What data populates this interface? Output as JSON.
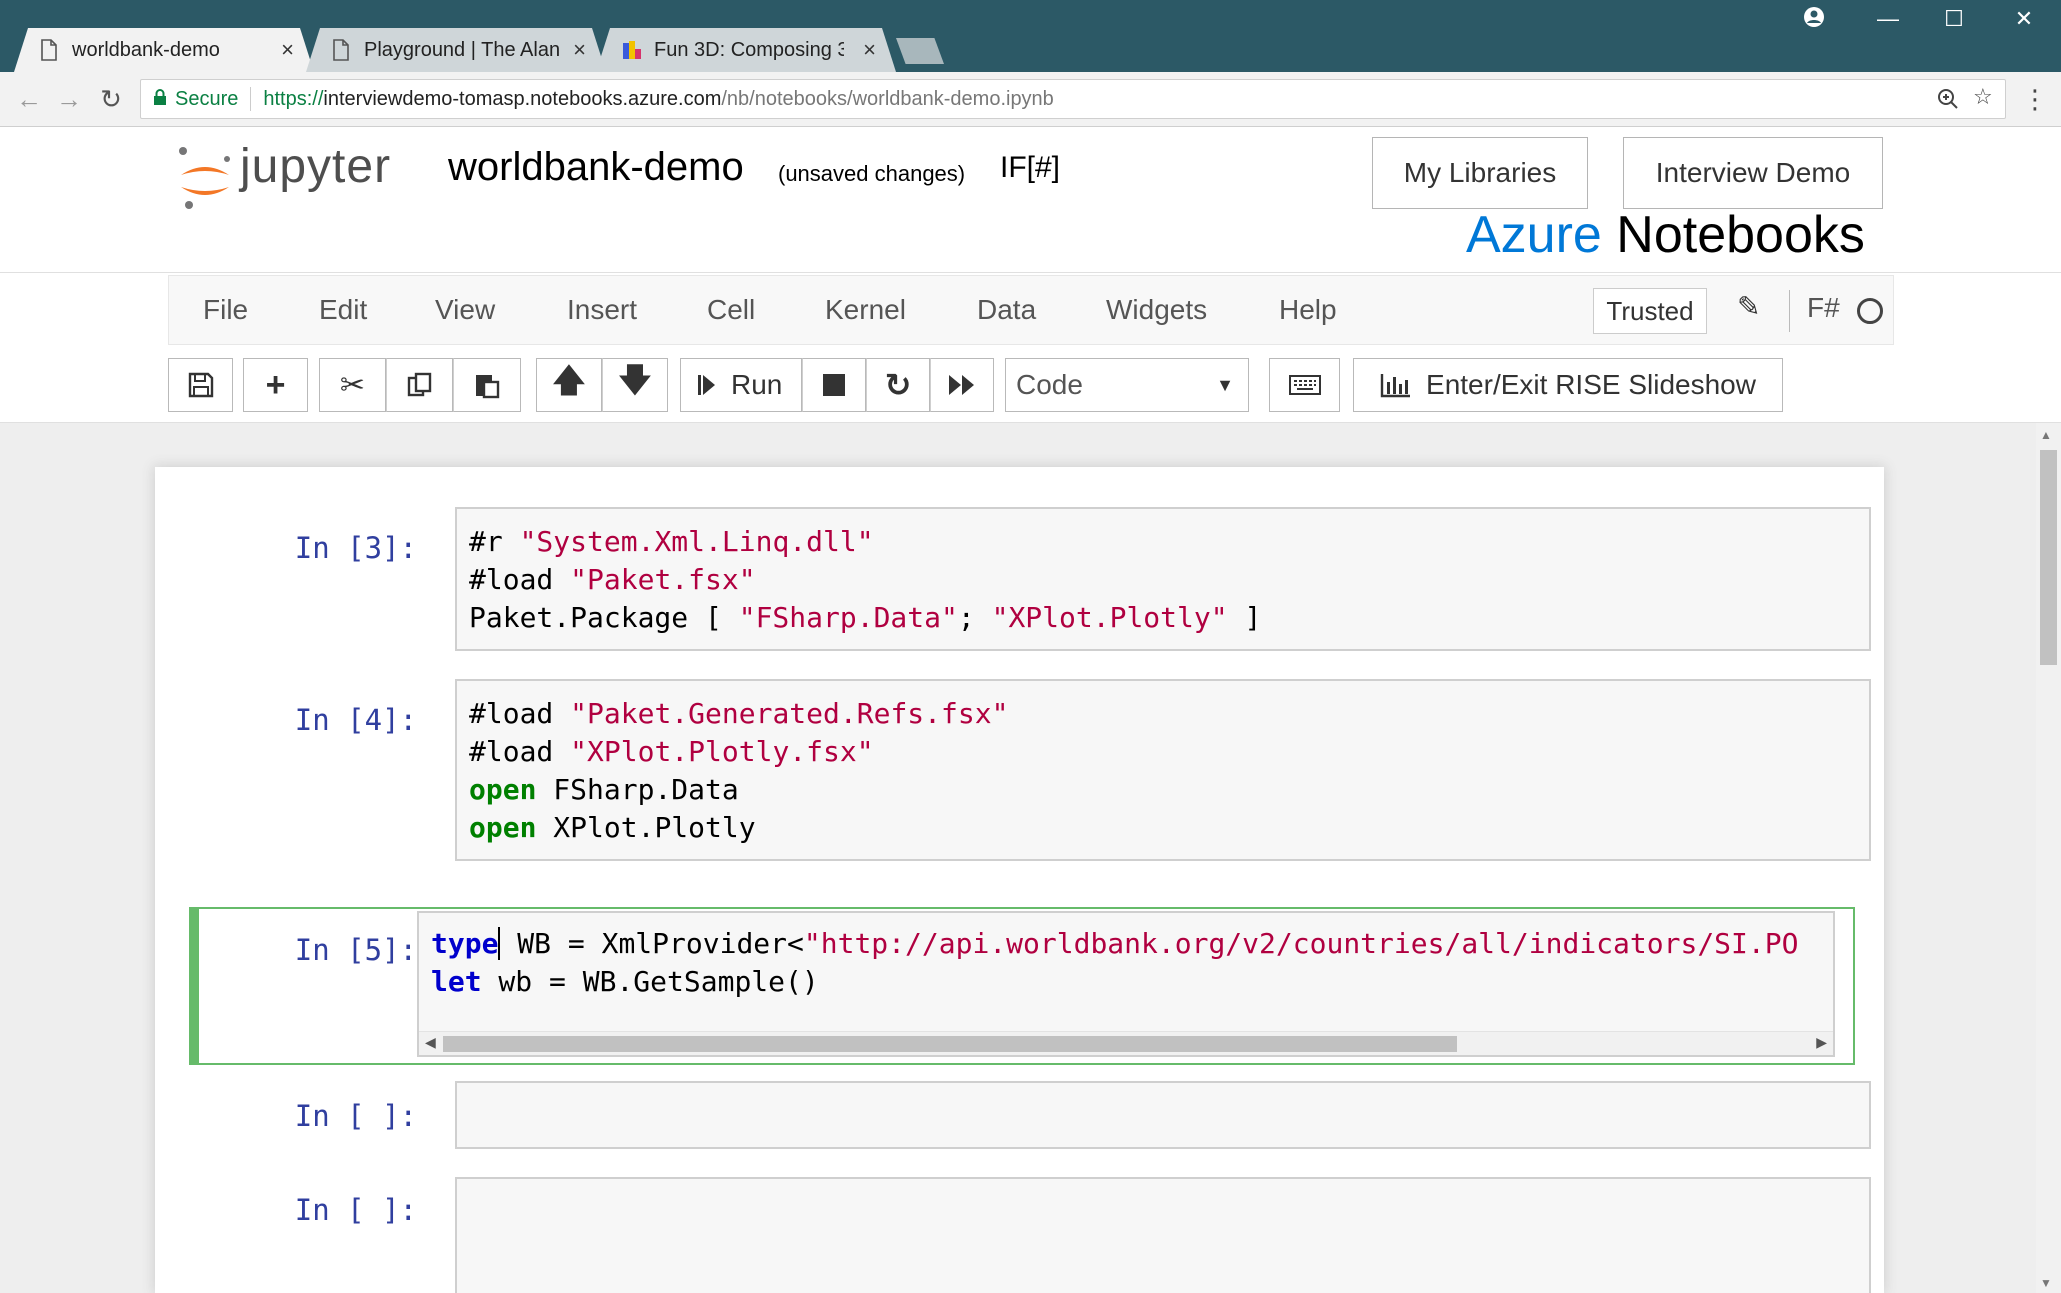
{
  "browser": {
    "tabs": [
      {
        "title": "worldbank-demo",
        "active": true
      },
      {
        "title": "Playground | The Alan Tu",
        "active": false
      },
      {
        "title": "Fun 3D: Composing 3D o",
        "active": false
      }
    ],
    "close_glyph": "×",
    "secure_label": "Secure",
    "url_proto": "https://",
    "url_host": "interviewdemo-tomasp.notebooks.azure.com",
    "url_path": "/nb/notebooks/worldbank-demo.ipynb"
  },
  "header": {
    "logo_text": "jupyter",
    "notebook_name": "worldbank-demo",
    "save_status": "(unsaved changes)",
    "kernel_label": "IF[#]",
    "my_libraries": "My Libraries",
    "interview_demo": "Interview Demo",
    "azure_part1": "Azure",
    "azure_part2": "Notebooks"
  },
  "menu": {
    "items": [
      "File",
      "Edit",
      "View",
      "Insert",
      "Cell",
      "Kernel",
      "Data",
      "Widgets",
      "Help"
    ],
    "trusted": "Trusted",
    "kernel_lang": "F#"
  },
  "toolbar": {
    "run_label": "Run",
    "cell_type": "Code",
    "rise_label": "Enter/Exit RISE Slideshow"
  },
  "cells": [
    {
      "prompt": "In [3]:"
    },
    {
      "prompt": "In [4]:"
    },
    {
      "prompt": "In [5]:"
    },
    {
      "prompt": "In [ ]:"
    },
    {
      "prompt": "In [ ]:"
    }
  ],
  "code": {
    "c3": {
      "l1_a": "#r ",
      "l1_s": "\"System.Xml.Linq.dll\"",
      "l2_a": "#load ",
      "l2_s": "\"Paket.fsx\"",
      "l3_a": "Paket.Package [ ",
      "l3_s1": "\"FSharp.Data\"",
      "l3_b": "; ",
      "l3_s2": "\"XPlot.Plotly\"",
      "l3_c": " ]"
    },
    "c4": {
      "l1_a": "#load ",
      "l1_s": "\"Paket.Generated.Refs.fsx\"",
      "l2_a": "#load ",
      "l2_s": "\"XPlot.Plotly.fsx\"",
      "l3_k": "open",
      "l3_a": " FSharp.Data",
      "l4_k": "open",
      "l4_a": " XPlot.Plotly"
    },
    "c5": {
      "l1_k": "type",
      "l1_a": " WB = XmlProvider<",
      "l1_s": "\"http://api.worldbank.org/v2/countries/all/indicators/SI.PO",
      "l2_k": "let",
      "l2_a": " wb = WB.GetSample()"
    }
  }
}
